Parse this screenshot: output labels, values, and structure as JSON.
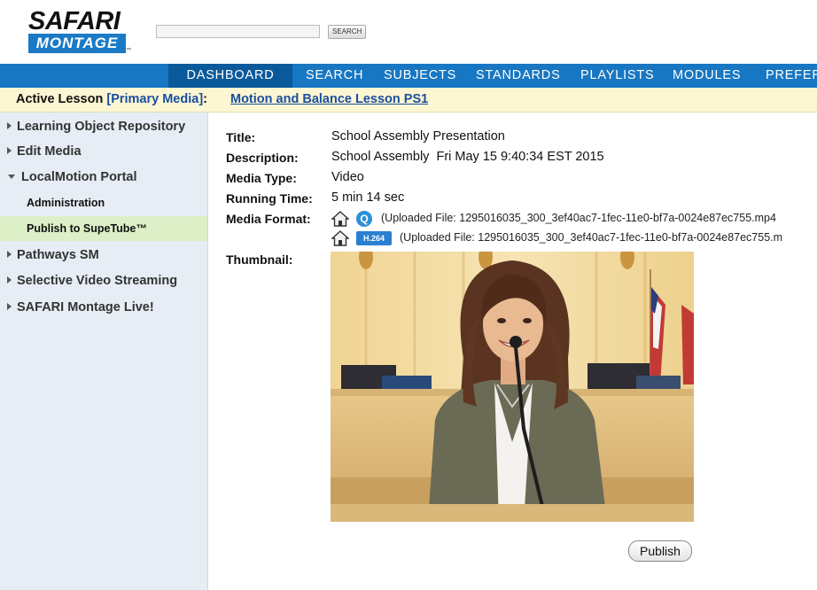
{
  "header": {
    "logo_top": "SAFARI",
    "logo_bottom": "MONTAGE",
    "logo_tm": "™",
    "search_value": "",
    "search_button": "SEARCH"
  },
  "nav": {
    "items": [
      "DASHBOARD",
      "SEARCH",
      "SUBJECTS",
      "STANDARDS",
      "PLAYLISTS",
      "MODULES",
      "PREFER"
    ],
    "active_index": 0
  },
  "lesson": {
    "label": "Active Lesson",
    "primary": "[Primary Media]",
    "colon": ":",
    "link": "Motion and Balance Lesson PS1"
  },
  "sidebar": {
    "items": [
      {
        "label": "Learning Object Repository"
      },
      {
        "label": "Edit Media"
      },
      {
        "label": "LocalMotion Portal"
      },
      {
        "label": "Administration"
      },
      {
        "label": "Publish to SupeTube™"
      },
      {
        "label": "Pathways SM"
      },
      {
        "label": "Selective Video Streaming"
      },
      {
        "label": "SAFARI Montage Live!"
      }
    ]
  },
  "details": {
    "title_label": "Title:",
    "title_value": "School Assembly Presentation",
    "description_label": "Description:",
    "description_value": "School Assembly  Fri May 15 9:40:34 EST 2015",
    "media_type_label": "Media Type:",
    "media_type_value": "Video",
    "running_time_label": "Running Time:",
    "running_time_value": "5 min 14 sec",
    "media_format_label": "Media Format:",
    "formats": [
      {
        "badge": "Q",
        "file": "(Uploaded File: 1295016035_300_3ef40ac7-1fec-11e0-bf7a-0024e87ec755.mp4"
      },
      {
        "badge": "H.264",
        "file": "(Uploaded File: 1295016035_300_3ef40ac7-1fec-11e0-bf7a-0024e87ec755.m"
      }
    ],
    "thumbnail_label": "Thumbnail:"
  },
  "actions": {
    "publish": "Publish"
  },
  "colors": {
    "nav_bg": "#1877c2",
    "nav_active": "#0a5a9b",
    "lesson_bg": "#fdf6d3",
    "sidebar_bg": "#e7edf4",
    "selected_bg": "#dcefc6"
  }
}
